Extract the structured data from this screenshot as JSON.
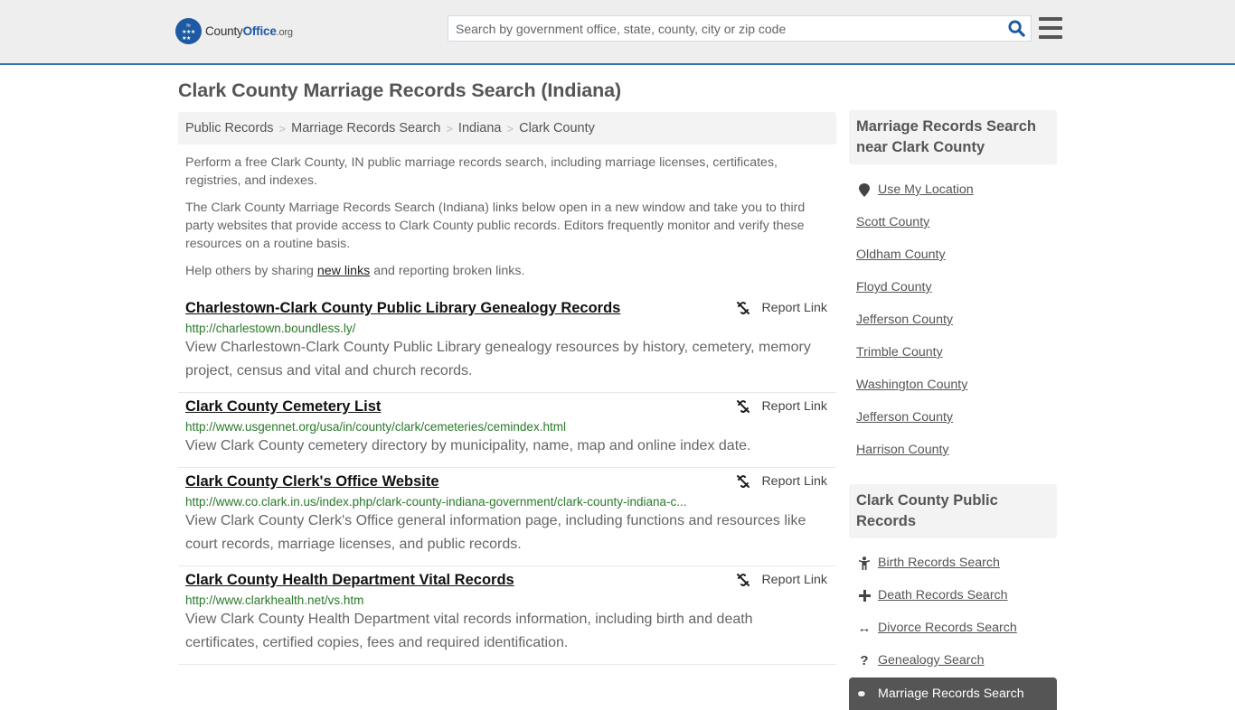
{
  "header": {
    "logo": {
      "name": "County",
      "brand": "Office",
      "tld": ".org"
    },
    "search": {
      "placeholder": "Search by government office, state, county, city or zip code",
      "value": ""
    },
    "brand_color": "#1d5aa3",
    "accent_border": "#2e73b0"
  },
  "page": {
    "title": "Clark County Marriage Records Search (Indiana)",
    "breadcrumb": [
      "Public Records",
      "Marriage Records Search",
      "Indiana",
      "Clark County"
    ],
    "intro": {
      "p1": "Perform a free Clark County, IN public marriage records search, including marriage licenses, certificates, registries, and indexes.",
      "p2": "The Clark County Marriage Records Search (Indiana) links below open in a new window and take you to third party websites that provide access to Clark County public records. Editors frequently monitor and verify these resources on a routine basis.",
      "p3_before": "Help others by sharing ",
      "p3_link": "new links",
      "p3_after": " and reporting broken links."
    },
    "report_label": "Report Link",
    "results": [
      {
        "title": "Charlestown-Clark County Public Library Genealogy Records",
        "url": "http://charlestown.boundless.ly/",
        "desc": "View Charlestown-Clark County Public Library genealogy resources by history, cemetery, memory project, census and vital and church records."
      },
      {
        "title": "Clark County Cemetery List",
        "url": "http://www.usgennet.org/usa/in/county/clark/cemeteries/cemindex.html",
        "desc": "View Clark County cemetery directory by municipality, name, map and online index date."
      },
      {
        "title": "Clark County Clerk's Office Website",
        "url": "http://www.co.clark.in.us/index.php/clark-county-indiana-government/clark-county-indiana-c...",
        "desc": "View Clark County Clerk's Office general information page, including functions and resources like court records, marriage licenses, and public records."
      },
      {
        "title": "Clark County Health Department Vital Records",
        "url": "http://www.clarkhealth.net/vs.htm",
        "desc": "View Clark County Health Department vital records information, including birth and death certificates, certified copies, fees and required identification."
      }
    ]
  },
  "sidebar": {
    "nearby": {
      "heading": "Marriage Records Search near Clark County",
      "use_location": "Use My Location",
      "counties": [
        "Scott County",
        "Oldham County",
        "Floyd County",
        "Jefferson County",
        "Trimble County",
        "Washington County",
        "Jefferson County",
        "Harrison County"
      ]
    },
    "public_records": {
      "heading": "Clark County Public Records",
      "items": [
        {
          "icon": "person-icon",
          "label": "Birth Records Search"
        },
        {
          "icon": "plus-icon",
          "label": "Death Records Search"
        },
        {
          "icon": "arrows-horizontal-icon",
          "label": "Divorce Records Search"
        },
        {
          "icon": "question-icon",
          "label": "Genealogy Search"
        }
      ],
      "active": {
        "icon": "rings-icon",
        "label": "Marriage Records Search"
      }
    }
  }
}
